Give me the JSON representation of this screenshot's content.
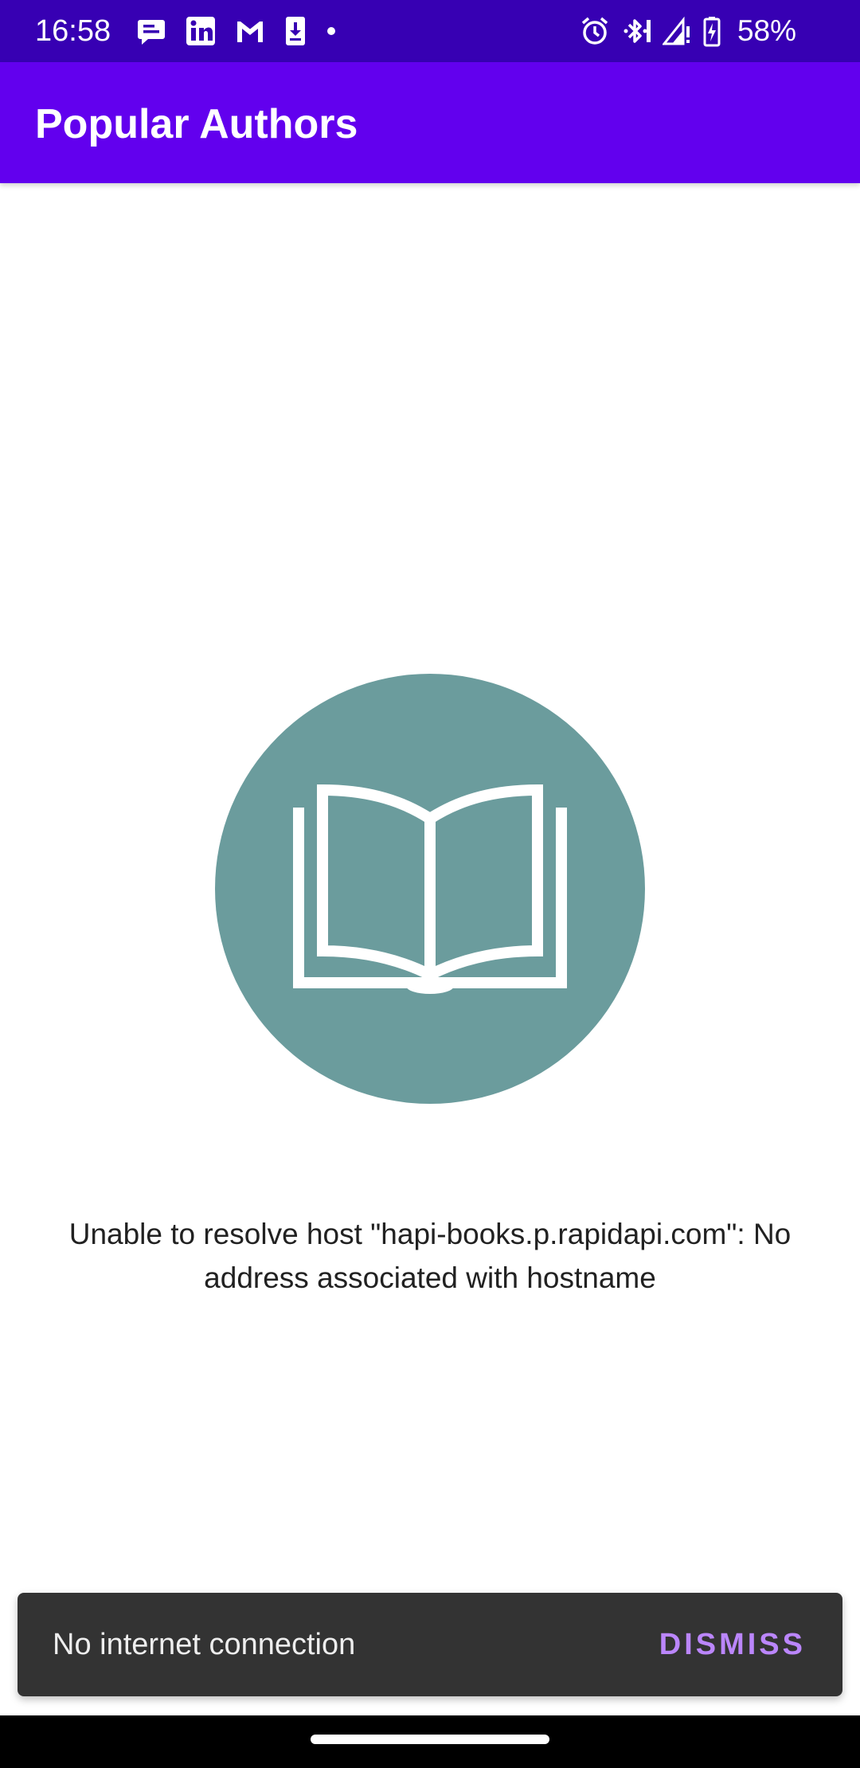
{
  "status_bar": {
    "time": "16:58",
    "left_icons": [
      "chat-icon",
      "linkedin-icon",
      "gmail-icon",
      "download-icon",
      "dot-icon"
    ],
    "right_icons": [
      "alarm-icon",
      "bluetooth-icon",
      "signal-icon",
      "battery-charging-icon"
    ],
    "battery": "58%",
    "background": "#3700b3"
  },
  "app_bar": {
    "title": "Popular Authors",
    "background": "#6200ee"
  },
  "error_state": {
    "icon": "open-book-icon",
    "icon_background": "#6b9c9d",
    "message": "Unable to resolve host \"hapi-books.p.rapidapi.com\": No address associated with hostname"
  },
  "snackbar": {
    "message": "No internet connection",
    "action_label": "DISMISS",
    "action_color": "#bb86fc"
  }
}
